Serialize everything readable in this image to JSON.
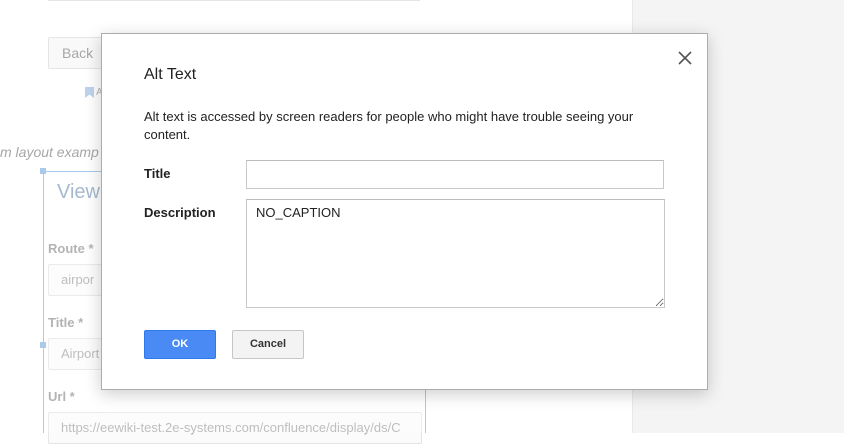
{
  "background": {
    "back_button": "Back",
    "bookmark_letter": "A",
    "caption": "m layout examp",
    "card_title": "View",
    "fields": [
      {
        "label": "Route *",
        "value": "airpor"
      },
      {
        "label": "Title *",
        "value": "Airport"
      },
      {
        "label": "Url *",
        "value": "https://eewiki-test.2e-systems.com/confluence/display/ds/C"
      }
    ]
  },
  "dialog": {
    "title": "Alt Text",
    "close_icon": "close-icon",
    "description": "Alt text is accessed by screen readers for people who might have trouble seeing your content.",
    "title_label": "Title",
    "title_value": "",
    "description_label": "Description",
    "description_value": "NO_CAPTION",
    "ok_label": "OK",
    "cancel_label": "Cancel"
  },
  "colors": {
    "ok_button": "#4a8af4",
    "selection_border": "#8fb9e3"
  }
}
